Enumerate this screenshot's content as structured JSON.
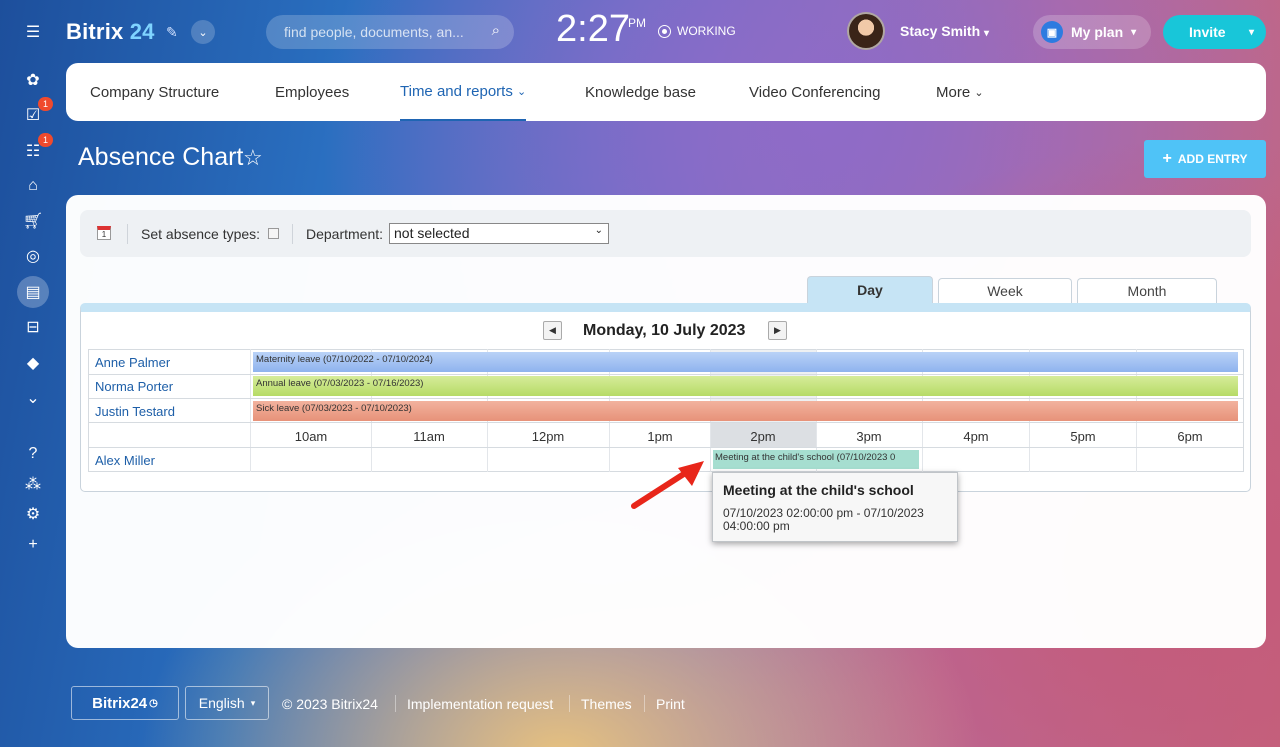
{
  "header": {
    "logo_text": "Bitrix",
    "logo_num": "24",
    "search_placeholder": "find people, documents, an...",
    "time": "2:27",
    "ampm": "PM",
    "status": "WORKING",
    "user_name": "Stacy Smith",
    "plan_label": "My plan",
    "invite_label": "Invite"
  },
  "sidebar": {
    "badges": [
      "1",
      "1"
    ]
  },
  "nav": {
    "items": [
      "Company Structure",
      "Employees",
      "Time and reports",
      "Knowledge base",
      "Video Conferencing",
      "More"
    ]
  },
  "page": {
    "title": "Absence Chart",
    "add_entry": "ADD ENTRY"
  },
  "filter": {
    "absence_types_label": "Set absence types:",
    "department_label": "Department:",
    "department_value": "not selected"
  },
  "view_tabs": [
    "Day",
    "Week",
    "Month"
  ],
  "chart": {
    "date": "Monday, 10 July 2023",
    "hours": [
      "10am",
      "11am",
      "12pm",
      "1pm",
      "2pm",
      "3pm",
      "4pm",
      "5pm",
      "6pm"
    ],
    "people": [
      "Anne Palmer",
      "Norma Porter",
      "Justin Testard",
      "Alex Miller"
    ],
    "bars": [
      "Maternity leave (07/10/2022 - 07/10/2024)",
      "Annual leave (07/03/2023 - 07/16/2023)",
      "Sick leave (07/03/2023 - 07/10/2023)"
    ],
    "meeting": "Meeting at the child's school (07/10/2023 0"
  },
  "tooltip": {
    "title": "Meeting at the child's school",
    "detail": "07/10/2023 02:00:00 pm - 07/10/2023 04:00:00 pm"
  },
  "footer": {
    "logo": "Bitrix24",
    "language": "English",
    "copyright": "© 2023 Bitrix24",
    "links": [
      "Implementation request",
      "Themes",
      "Print"
    ]
  }
}
